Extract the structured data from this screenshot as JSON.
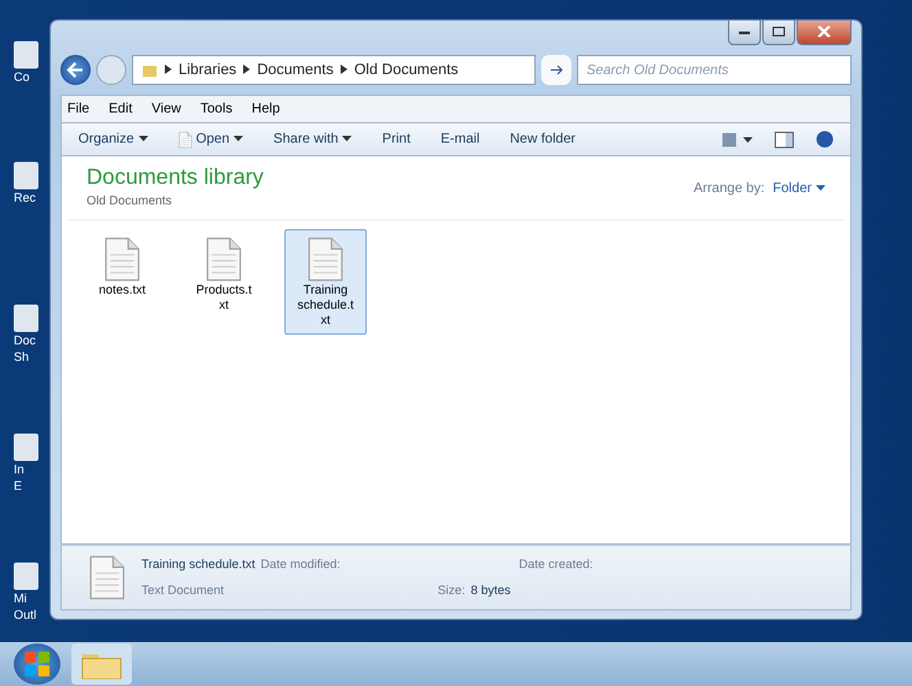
{
  "desktop_icons": [
    {
      "lines": [
        "Co"
      ]
    },
    {
      "lines": [
        "Rec"
      ]
    },
    {
      "lines": [
        "Doc",
        "Sh"
      ]
    },
    {
      "lines": [
        "In",
        "E"
      ]
    },
    {
      "lines": [
        "Mi",
        "Outl"
      ]
    }
  ],
  "window": {
    "controls": [
      {
        "kind": "minimize"
      },
      {
        "kind": "maximize"
      },
      {
        "kind": "close"
      }
    ],
    "breadcrumbs": [
      "Libraries",
      "Documents",
      "Old Documents"
    ],
    "search": {
      "placeholder": "Search Old Documents"
    },
    "menu": [
      "File",
      "Edit",
      "View",
      "Tools",
      "Help"
    ],
    "toolbar": [
      {
        "label": "Organize",
        "kind": "dropdown"
      },
      {
        "label": "Open",
        "kind": "icon-dropdown"
      },
      {
        "label": "Share with",
        "kind": "dropdown"
      },
      {
        "label": "Print",
        "kind": "plain"
      },
      {
        "label": "E-mail",
        "kind": "plain"
      },
      {
        "label": "New folder",
        "kind": "plain"
      }
    ]
  },
  "library": {
    "title": "Documents library",
    "subtitle": "Old Documents",
    "arrange_label": "Arrange by:",
    "arrange_value": "Folder"
  },
  "files": [
    {
      "name": "notes.txt",
      "selected": false
    },
    {
      "name": "Products.txt",
      "selected": false
    },
    {
      "name": "Training schedule.txt",
      "selected": true
    }
  ],
  "details": {
    "name": "Training schedule.txt",
    "type": "Text Document",
    "modified_label": "Date modified:",
    "created_label": "Date created:",
    "size_label": "Size:",
    "size_value": "8 bytes"
  }
}
